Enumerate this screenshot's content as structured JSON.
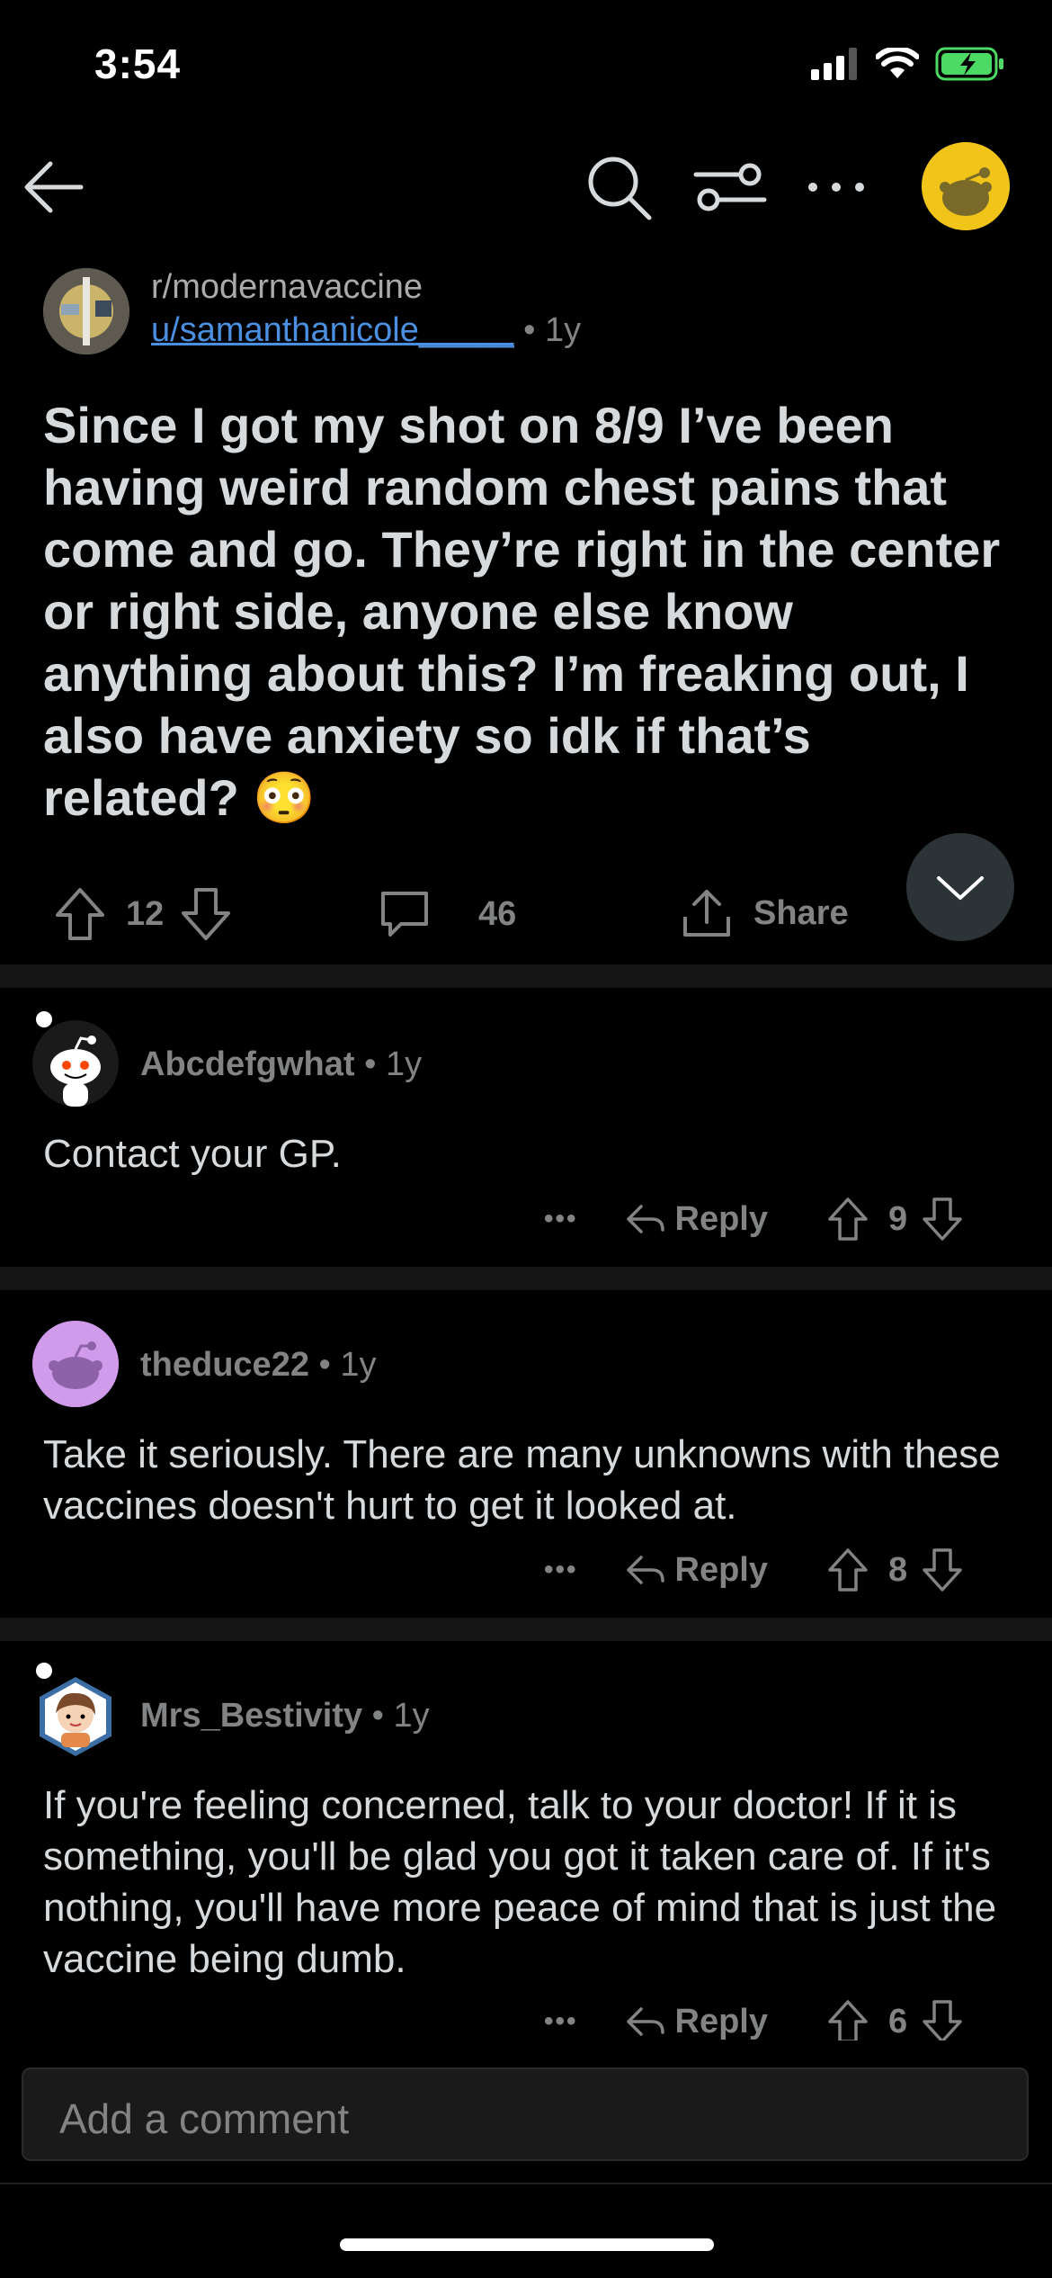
{
  "status_bar": {
    "time": "3:54"
  },
  "nav": {
    "icons": [
      "back-arrow-icon",
      "search-icon",
      "filter-icon",
      "more-icon",
      "avatar-icon"
    ]
  },
  "post": {
    "subreddit": "r/modernavaccine",
    "author": "u/samanthanicole_____",
    "age": " • 1y",
    "title": "Since I got my shot on 8/9 I’ve been having weird random chest pains that come and go. They’re right in the center or right side, anyone else know anything about this? I’m freaking out, I also have anxiety so idk if that’s related? 😳",
    "score": "12",
    "comments": "46",
    "share_label": "Share"
  },
  "comments": [
    {
      "author": "Abcdefgwhat",
      "age": " • 1y",
      "body": "Contact your GP.",
      "reply_label": "Reply",
      "score": "9",
      "more": "•••"
    },
    {
      "author": "theduce22",
      "age": " • 1y",
      "body": "Take it seriously. There are many unknowns with these vaccines doesn't hurt to get it looked at.",
      "reply_label": "Reply",
      "score": "8",
      "more": "•••"
    },
    {
      "author": "Mrs_Bestivity",
      "age": " • 1y",
      "body": "If you're feeling concerned, talk to your doctor! If it is something, you'll be glad you got it taken care of. If it's nothing, you'll have more peace of mind that is just the vaccine being dumb.",
      "reply_label": "Reply",
      "score": "6",
      "more": "•••"
    }
  ],
  "composer": {
    "placeholder": "Add a comment"
  },
  "colors": {
    "background": "#000000",
    "link": "#4a8fe0",
    "muted": "#818384",
    "text": "#d7dadc",
    "battery": "#4cd964"
  }
}
